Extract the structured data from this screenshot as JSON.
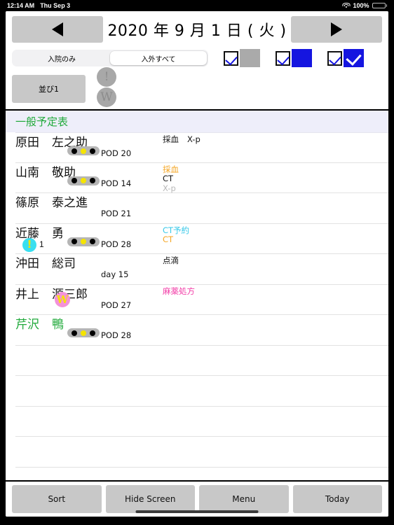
{
  "status_bar": {
    "time": "12:14 AM",
    "date": "Thu Sep 3",
    "battery_percent": "100%",
    "wifi_icon": "wifi-icon",
    "battery_icon": "battery-full-icon"
  },
  "top_nav": {
    "prev_icon": "triangle-left-icon",
    "next_icon": "triangle-right-icon",
    "date_title": "2020 年 9 月 1 日 ( 火 )"
  },
  "filters": {
    "segments": [
      {
        "label": "入院のみ",
        "active": false
      },
      {
        "label": "入外すべて",
        "active": true
      }
    ],
    "checkboxes": [
      {
        "checked": true,
        "swatch": "grey",
        "color": "#aaaaaa"
      },
      {
        "checked": true,
        "swatch": "blue",
        "color": "#1515e0"
      },
      {
        "checked": true,
        "swatch": "bluecheck",
        "color": "#1515e0"
      }
    ]
  },
  "sort_row": {
    "sort_button_label": "並び1",
    "legend_icons": [
      {
        "glyph": "!",
        "name": "alert-badge-disabled-icon"
      },
      {
        "glyph": "W",
        "name": "w-badge-disabled-icon"
      }
    ]
  },
  "section": {
    "title": "一般予定表",
    "title_color": "#22aa3c",
    "background": "#eeeefa"
  },
  "patients": [
    {
      "surname": "原田",
      "given": "左之助",
      "name_color": "black",
      "pod": "POD 20",
      "indicator_pill": true,
      "alert": null,
      "alert_count": null,
      "w_badge": false,
      "orders_inline": true,
      "orders": [
        {
          "text": "採血",
          "color": "black"
        },
        {
          "text": "X-p",
          "color": "black"
        }
      ]
    },
    {
      "surname": "山南",
      "given": "敬助",
      "name_color": "black",
      "pod": "POD 14",
      "indicator_pill": true,
      "alert": null,
      "alert_count": null,
      "w_badge": false,
      "orders_inline": false,
      "orders": [
        {
          "text": "採血",
          "color": "orange"
        },
        {
          "text": "CT",
          "color": "black"
        },
        {
          "text": "X-p",
          "color": "grey"
        }
      ]
    },
    {
      "surname": "篠原",
      "given": "泰之進",
      "name_color": "black",
      "pod": "POD 21",
      "indicator_pill": false,
      "alert": null,
      "alert_count": null,
      "w_badge": false,
      "orders_inline": false,
      "orders": []
    },
    {
      "surname": "近藤",
      "given": "勇",
      "name_color": "black",
      "pod": "POD 28",
      "indicator_pill": true,
      "alert": "!",
      "alert_count": "1",
      "w_badge": false,
      "orders_inline": false,
      "orders": [
        {
          "text": "CT予約",
          "color": "cyan"
        },
        {
          "text": "CT",
          "color": "orange"
        }
      ]
    },
    {
      "surname": "沖田",
      "given": "総司",
      "name_color": "black",
      "pod": "day 15",
      "indicator_pill": false,
      "alert": null,
      "alert_count": null,
      "w_badge": false,
      "orders_inline": false,
      "orders": [
        {
          "text": "点滴",
          "color": "black"
        }
      ]
    },
    {
      "surname": "井上",
      "given": "源三郎",
      "name_color": "black",
      "pod": "POD 27",
      "indicator_pill": false,
      "alert": null,
      "alert_count": null,
      "w_badge": true,
      "orders_inline": false,
      "orders": [
        {
          "text": "麻薬処方",
          "color": "pink"
        }
      ]
    },
    {
      "surname": "芹沢",
      "given": "鴨",
      "name_color": "green",
      "pod": "POD 28",
      "indicator_pill": true,
      "alert": null,
      "alert_count": null,
      "w_badge": false,
      "orders_inline": false,
      "orders": []
    }
  ],
  "empty_row_count": 4,
  "toolbar": {
    "buttons": [
      {
        "label": "Sort"
      },
      {
        "label": "Hide Screen"
      },
      {
        "label": "Menu"
      },
      {
        "label": "Today"
      }
    ]
  }
}
